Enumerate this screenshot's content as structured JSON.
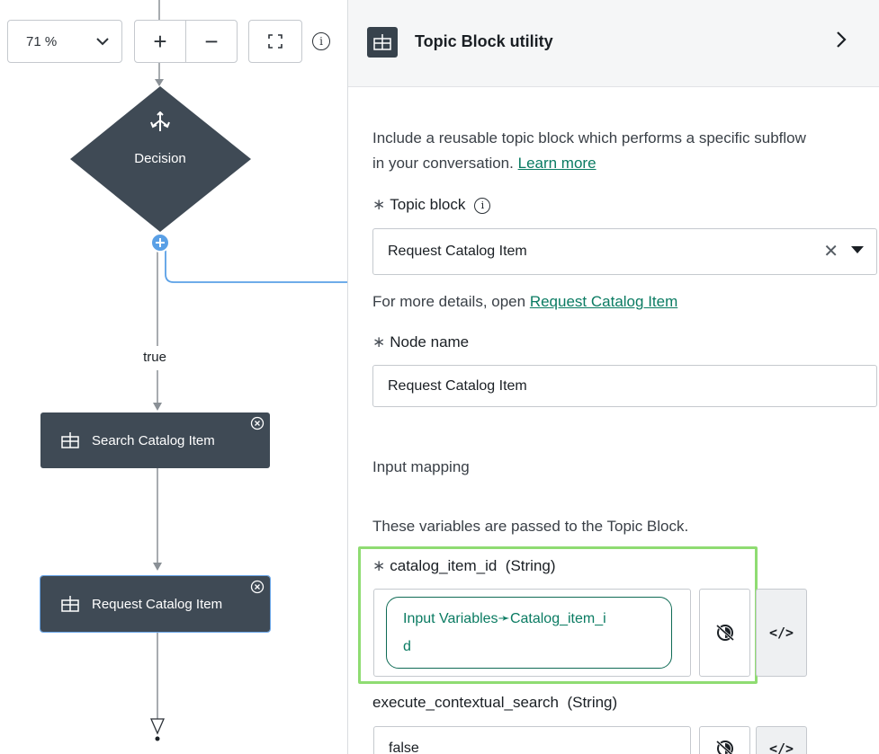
{
  "canvas": {
    "zoom_value": "71 %",
    "zoom_in": "+",
    "zoom_out": "−",
    "decision_label": "Decision",
    "true_label": "true",
    "nodes": [
      {
        "label": "Search Catalog Item"
      },
      {
        "label": "Request Catalog Item"
      }
    ]
  },
  "panel": {
    "title": "Topic Block utility",
    "description": "Include a reusable topic block which performs a specific subflow",
    "description_line2": "in your conversation.",
    "learn_more": "Learn more",
    "topic_block_label": "Topic block",
    "topic_block_value": "Request Catalog Item",
    "details_prefix": "For more details, open",
    "details_link": "Request Catalog Item",
    "node_name_label": "Node name",
    "node_name_value": "Request Catalog Item",
    "input_mapping_heading": "Input mapping",
    "input_mapping_desc": "These variables are passed to the Topic Block.",
    "var1_label": "catalog_item_id",
    "var1_type": "(String)",
    "var1_pill_line1": "Input Variables➛Catalog_item_i",
    "var1_pill_line2": "d",
    "var2_label": "execute_contextual_search",
    "var2_type": "(String)",
    "var2_value": "false",
    "code_label": "</>",
    "required_mark": "∗"
  },
  "colors": {
    "node_bg": "#3f4a55",
    "link": "#0a7b62",
    "highlight": "#8fdc72",
    "connector": "#5aa0e6"
  }
}
